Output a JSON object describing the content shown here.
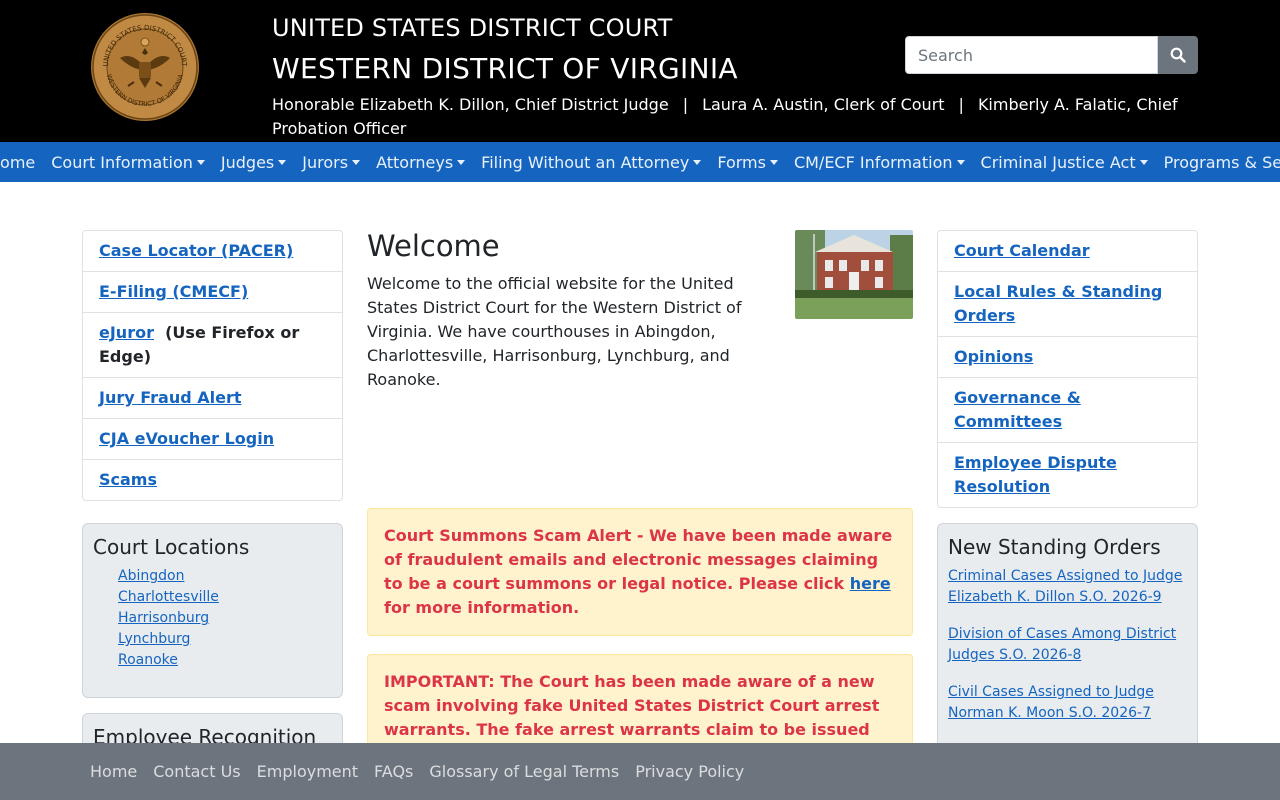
{
  "header": {
    "seal_alt": "United States District Court Western District of Virginia seal",
    "line1": "UNITED STATES DISTRICT COURT",
    "line2": "WESTERN DISTRICT OF VIRGINIA",
    "officials": [
      "Honorable Elizabeth K. Dillon, Chief District Judge",
      "Laura A. Austin, Clerk of Court",
      "Kimberly A. Falatic, Chief Probation Officer"
    ],
    "separator": "|",
    "search": {
      "placeholder": "Search",
      "value": "",
      "icon": "search-icon"
    }
  },
  "nav": {
    "items": [
      "Home",
      "Court Information",
      "Judges",
      "Jurors",
      "Attorneys",
      "Filing Without an Attorney",
      "Forms",
      "CM/ECF Information",
      "Criminal Justice Act",
      "Programs & Services"
    ]
  },
  "left": {
    "quick_links": {
      "pacer": "Case Locator (PACER)",
      "cmecf": "E-Filing (CMECF)",
      "ejuror": "eJuror",
      "ejuror_note": "(Use Firefox or Edge)",
      "jury_fraud": "Jury Fraud Alert",
      "cja": "CJA eVoucher Login",
      "scams": "Scams"
    },
    "locations": {
      "title": "Court Locations",
      "items": [
        "Abingdon",
        "Charlottesville",
        "Harrisonburg",
        "Lynchburg",
        "Roanoke"
      ]
    },
    "employee_recognition": {
      "title": "Employee Recognition"
    }
  },
  "main": {
    "title": "Welcome",
    "intro": "Welcome to the official website for the United States District Court for the Western District of Virginia. We have courthouses in Abingdon, Charlottesville, Harrisonburg, Lynchburg, and Roanoke.",
    "alert1": {
      "text_before": "Court Summons Scam Alert - We have been made aware of fraudulent emails and electronic messages claiming to be a court summons or legal notice.  Please click ",
      "link": "here",
      "text_after": " for more information."
    },
    "alert2": {
      "text": "IMPORTANT: The Court has been made aware of a new scam involving fake United States District Court arrest warrants. The fake arrest warrants claim to be issued"
    }
  },
  "right": {
    "links": {
      "calendar": "Court Calendar",
      "local_rules": "Local Rules & Standing Orders",
      "opinions": "Opinions",
      "governance": "Governance & Committees",
      "dispute": "Employee Dispute Resolution"
    },
    "standing_orders": {
      "title": "New Standing Orders",
      "items": [
        "Criminal Cases Assigned to Judge Elizabeth K. Dillon S.O. 2026-9",
        "Division of Cases Among District Judges S.O. 2026-8",
        "Civil Cases Assigned to Judge Norman K. Moon S.O. 2026-7"
      ]
    }
  },
  "footer": {
    "links": [
      "Home",
      "Contact Us",
      "Employment",
      "FAQs",
      "Glossary of Legal Terms",
      "Privacy Policy"
    ]
  },
  "colors": {
    "header_bg": "#000000",
    "nav_bg": "#1565c0",
    "link": "#1565c0",
    "alert_bg": "#fff3cd",
    "alert_text": "#dc3545",
    "card_bg": "#e9ecef",
    "footer_bg": "#6c757d",
    "seal_gold": "#b5823f"
  }
}
